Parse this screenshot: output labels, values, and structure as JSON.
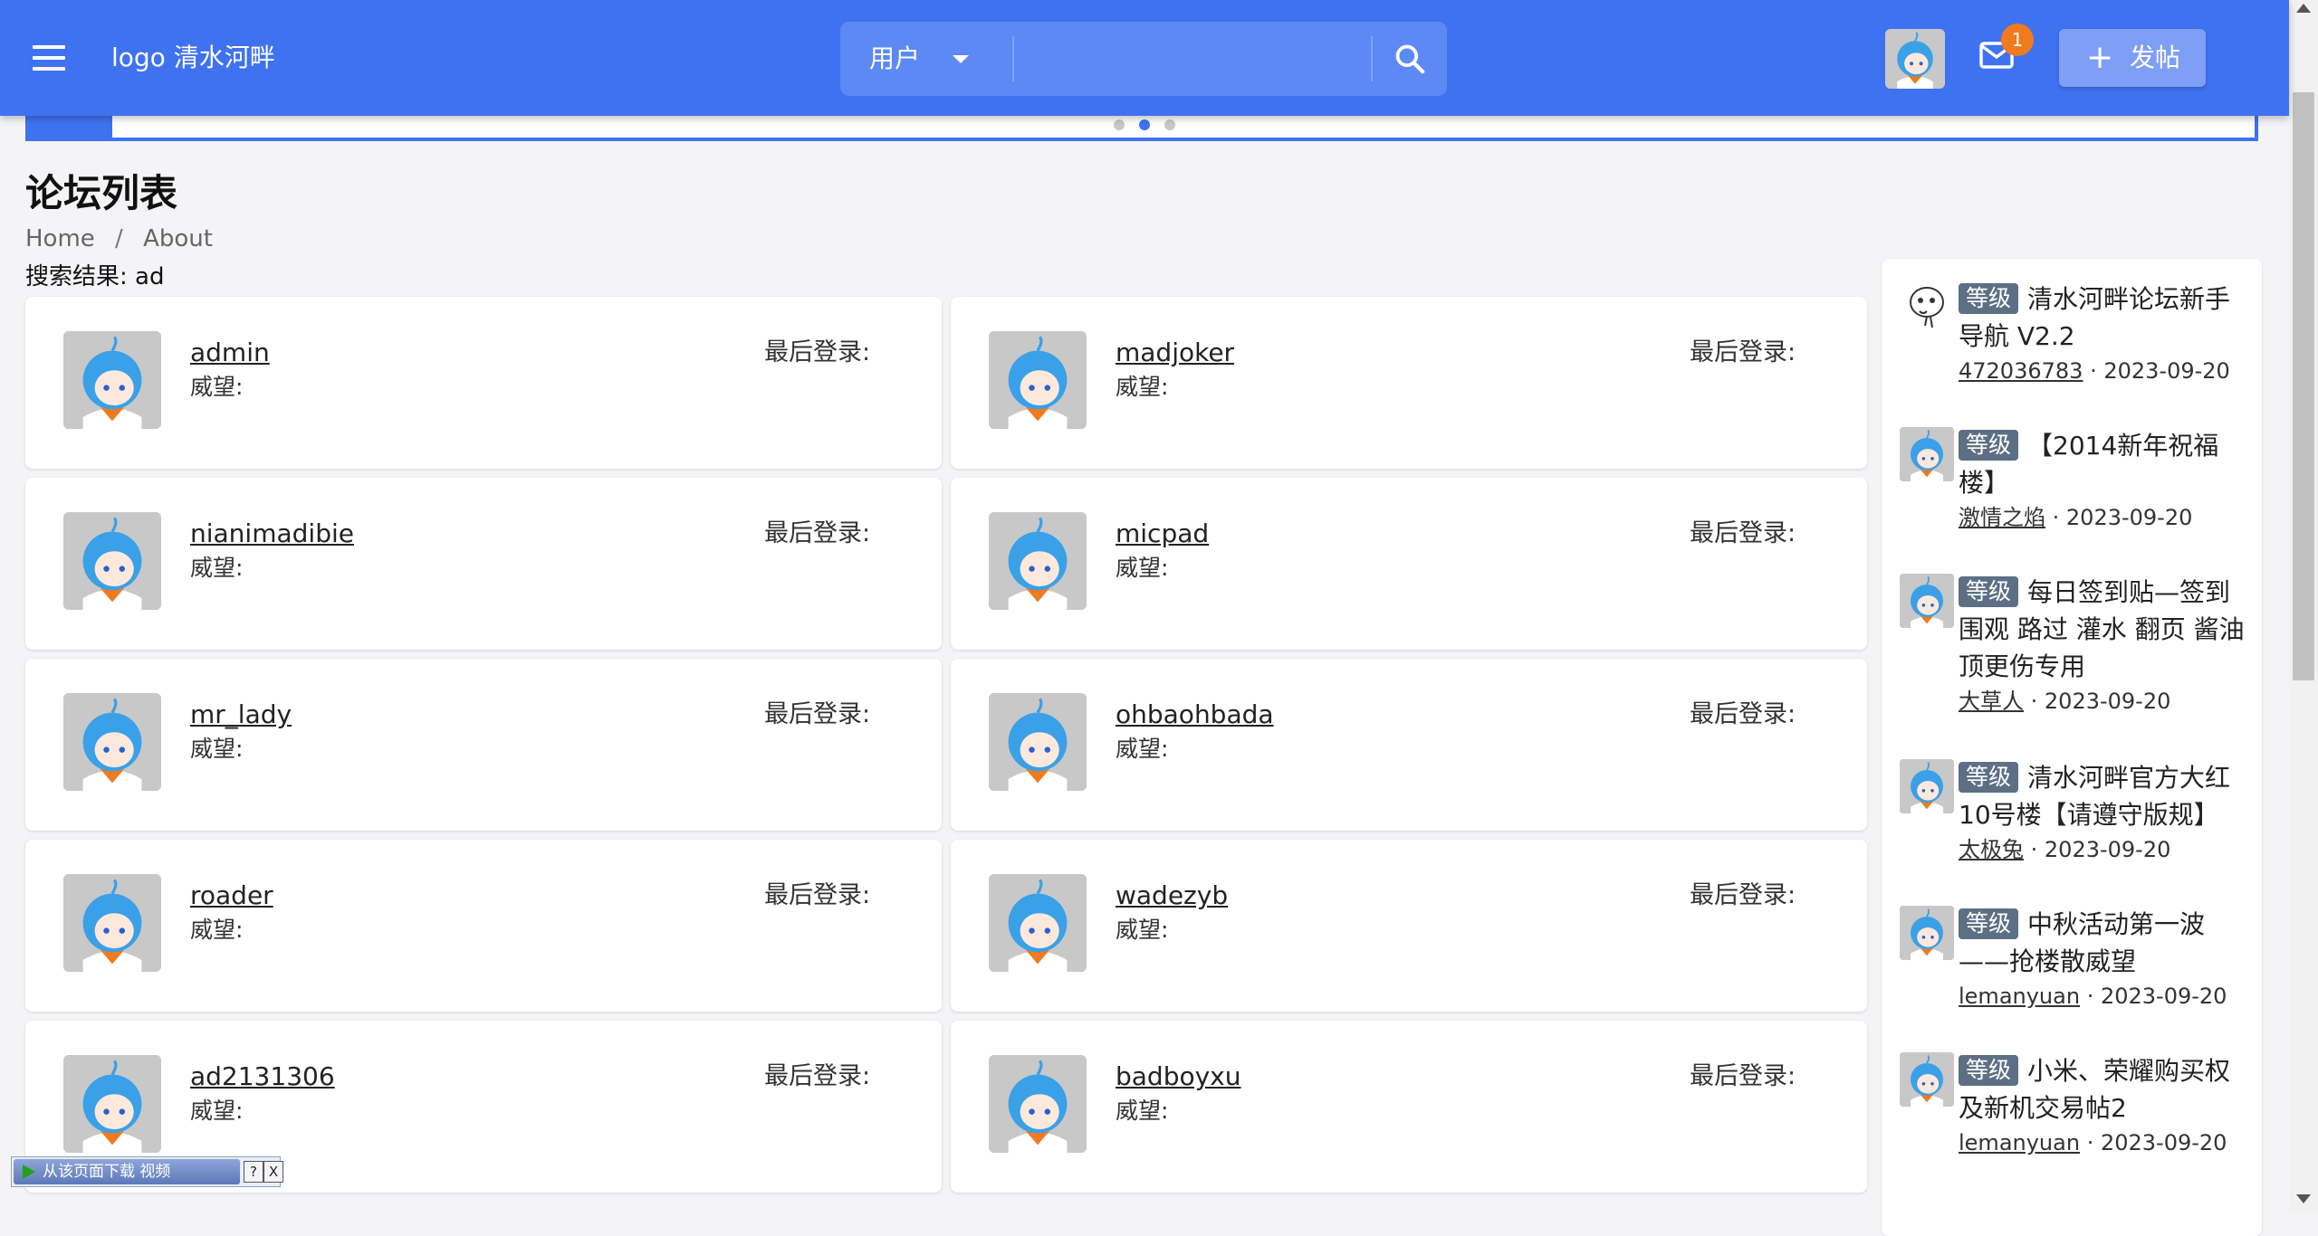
{
  "header": {
    "logo_text": "logo 清水河畔",
    "search_type": "用户",
    "search_value": "",
    "mail_badge": "1",
    "post_button": "发帖",
    "accent_color": "#3f72f0"
  },
  "icons": {
    "menu": "menu-icon",
    "search": "search-icon",
    "mail": "mail-icon",
    "add": "plus-icon"
  },
  "carousel": {
    "slides": 3,
    "active_slide": 2
  },
  "page": {
    "title": "论坛列表",
    "breadcrumb": [
      "Home",
      "About"
    ],
    "breadcrumb_separator": "/",
    "search_result": "搜索结果: ad"
  },
  "user_card_labels": {
    "prestige": "威望:",
    "last_login": "最后登录:"
  },
  "users": [
    {
      "name": "admin"
    },
    {
      "name": "madjoker"
    },
    {
      "name": "nianimadibie"
    },
    {
      "name": "micpad"
    },
    {
      "name": "mr_lady"
    },
    {
      "name": "ohbaohbada"
    },
    {
      "name": "roader"
    },
    {
      "name": "wadezyb"
    },
    {
      "name": "ad2131306"
    },
    {
      "name": "badboyxu"
    }
  ],
  "sidebar": {
    "level_label": "等级",
    "posts": [
      {
        "title": "清水河畔论坛新手导航 V2.2",
        "author": "472036783",
        "date": "2023-09-20"
      },
      {
        "title": "【2014新年祝福楼】",
        "author": "激情之焰",
        "date": "2023-09-20"
      },
      {
        "title": "每日签到贴—签到 围观 路过 灌水 翻页 酱油 顶更伤专用",
        "author": "大草人",
        "date": "2023-09-20"
      },
      {
        "title": "清水河畔官方大红10号楼【请遵守版规】",
        "author": "太极兔",
        "date": "2023-09-20"
      },
      {
        "title": "中秋活动第一波——抢楼散威望",
        "author": "lemanyuan",
        "date": "2023-09-20"
      },
      {
        "title": "小米、荣耀购买权及新机交易帖2",
        "author": "lemanyuan",
        "date": "2023-09-20"
      }
    ]
  },
  "download_widget": {
    "label": "从该页面下载 视频",
    "help": "?",
    "close": "X"
  }
}
